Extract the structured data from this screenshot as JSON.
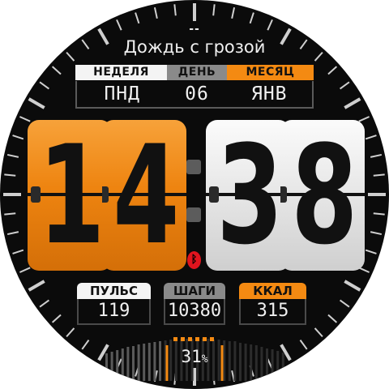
{
  "watch_face": {
    "top_indicator": "--",
    "weather": "Дождь с грозой",
    "date_labels": {
      "week": "НЕДЕЛЯ",
      "day": "ДЕНЬ",
      "month": "МЕСЯЦ"
    },
    "date_values": {
      "week": "ПНД",
      "day": "06",
      "month": "ЯНВ"
    },
    "time": {
      "h1": "1",
      "h2": "4",
      "m1": "3",
      "m2": "8"
    },
    "stats": {
      "pulse_label": "ПУЛЬС",
      "pulse_value": "119",
      "steps_label": "ШАГИ",
      "steps_value": "10380",
      "kcal_label": "ККАЛ",
      "kcal_value": "315"
    },
    "battery": {
      "value": "31",
      "unit": "%",
      "level": 0.31
    },
    "icons": {
      "bluetooth": "bluetooth-icon"
    },
    "colors": {
      "accent": "#f48a12",
      "background": "#0b0b0b",
      "bluetooth": "#e0141e"
    }
  }
}
